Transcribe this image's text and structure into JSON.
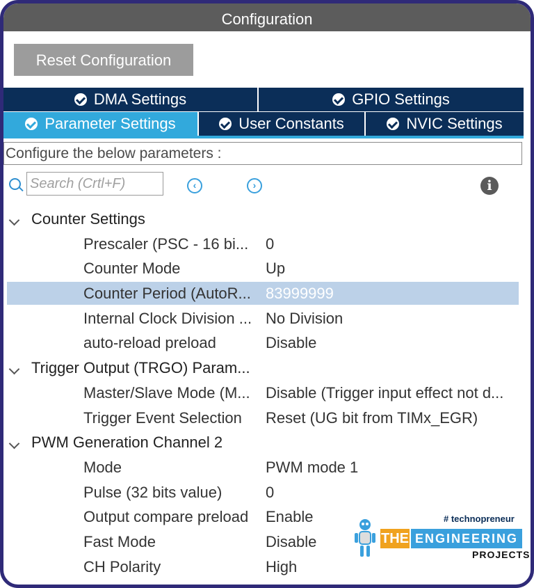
{
  "window": {
    "title": "Configuration"
  },
  "toolbar": {
    "reset_label": "Reset Configuration"
  },
  "tabs": {
    "row1": [
      {
        "label": "DMA Settings"
      },
      {
        "label": "GPIO Settings"
      }
    ],
    "row2": [
      {
        "label": "Parameter Settings",
        "active": true
      },
      {
        "label": "User Constants"
      },
      {
        "label": "NVIC Settings"
      }
    ]
  },
  "description": "Configure the below parameters :",
  "search": {
    "placeholder": "Search (Crtl+F)",
    "prev_icon": "chevron-left-circle-icon",
    "next_icon": "chevron-right-circle-icon",
    "info_icon": "info-icon"
  },
  "sections": [
    {
      "label": "Counter Settings",
      "params": [
        {
          "name": "Prescaler (PSC - 16 bi...",
          "value": "0"
        },
        {
          "name": "Counter Mode",
          "value": "Up"
        },
        {
          "name": "Counter Period (AutoR...",
          "value": "83999999",
          "selected": true
        },
        {
          "name": "Internal Clock Division ...",
          "value": "No Division"
        },
        {
          "name": "auto-reload preload",
          "value": "Disable"
        }
      ]
    },
    {
      "label": "Trigger Output (TRGO) Param...",
      "params": [
        {
          "name": "Master/Slave Mode (M...",
          "value": "Disable (Trigger input effect not d..."
        },
        {
          "name": "Trigger Event Selection",
          "value": "Reset (UG bit from TIMx_EGR)"
        }
      ]
    },
    {
      "label": "PWM Generation Channel 2",
      "params": [
        {
          "name": "Mode",
          "value": "PWM mode 1"
        },
        {
          "name": "Pulse (32 bits value)",
          "value": "0"
        },
        {
          "name": "Output compare preload",
          "value": "Enable"
        },
        {
          "name": "Fast Mode",
          "value": "Disable"
        },
        {
          "name": "CH Polarity",
          "value": "High"
        }
      ]
    }
  ],
  "watermark": {
    "tag": "# technopreneur",
    "the": "THE",
    "engineering": "ENGINEERING",
    "projects": "PROJECTS"
  },
  "colors": {
    "tab_bg": "#0b2e58",
    "tab_active": "#32a9dc",
    "title_bg": "#5c5c5c",
    "selection": "#bcd1e8",
    "frame": "#2f2a78"
  }
}
